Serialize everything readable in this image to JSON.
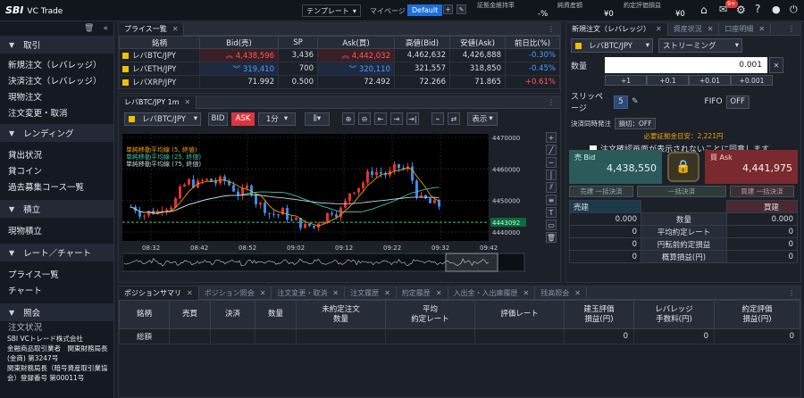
{
  "header": {
    "logo": "SBI",
    "app_name": "VC Trade",
    "template_label": "テンプレート",
    "mypage_label": "マイページ",
    "mypage_value": "Default",
    "margin_rate_label": "証拠金維持率",
    "margin_rate_value": "-%",
    "net_assets_label": "純資産額",
    "net_assets_value": "¥0",
    "pnl_label": "約定評価損益",
    "pnl_value": "¥0",
    "badge": "9+"
  },
  "sidebar": {
    "sections": [
      {
        "title": "取引",
        "items": [
          "新規注文（レバレッジ）",
          "決済注文（レバレッジ）",
          "現物注文",
          "注文変更・取消"
        ]
      },
      {
        "title": "レンディング",
        "items": [
          "貸出状況",
          "貸コイン",
          "過去募集コース一覧"
        ]
      },
      {
        "title": "積立",
        "items": [
          "現物積立"
        ]
      },
      {
        "title": "レート／チャート",
        "items": [
          "プライス一覧",
          "チャート"
        ]
      },
      {
        "title": "照会",
        "items": [
          "注文状況"
        ]
      }
    ],
    "footer": [
      "SBI VCトレード株式会社",
      "金融商品取引業者　関東財務局長",
      "(金商) 第3247号",
      "関東財務局長（暗号資産取引業協",
      "会）登録番号 第00011号"
    ]
  },
  "price_list": {
    "tab": "プライス一覧",
    "headers": [
      "銘柄",
      "Bid(売)",
      "SP",
      "Ask(買)",
      "高値(Bid)",
      "安値(Ask)",
      "前日比(%)"
    ],
    "rows": [
      {
        "symbol": "レバBTC/JPY",
        "bid": "4,438,596",
        "sp": "3,436",
        "ask": "4,442,032",
        "high": "4,462,632",
        "low": "4,426,888",
        "change": "-0.30%"
      },
      {
        "symbol": "レバETH/JPY",
        "bid": "319,410",
        "sp": "700",
        "ask": "320,110",
        "high": "321,557",
        "low": "318,850",
        "change": "-0.45%"
      },
      {
        "symbol": "レバXRP/JPY",
        "bid": "71.992",
        "sp": "0.500",
        "ask": "72.492",
        "high": "72.266",
        "low": "71.865",
        "change": "+0.61%"
      }
    ]
  },
  "chart": {
    "tab": "レバBTC/JPY 1m",
    "symbol": "レバBTC/JPY",
    "bid": "BID",
    "ask": "ASK",
    "interval": "1分",
    "display": "表示",
    "legend": [
      "単純移動平均線 (5, 終値)",
      "単純移動平均線 (25, 終値)",
      "単純移動平均線 (75, 終値)"
    ],
    "price_ticks": [
      "4470000",
      "4460000",
      "4450000",
      "4440000"
    ],
    "current_price": "4443092",
    "time_ticks": [
      "08:32",
      "08:42",
      "08:52",
      "09:02",
      "09:12",
      "09:22",
      "09:32",
      "09:42"
    ],
    "colors": {
      "up": "#e8312f",
      "down": "#3d8be8",
      "ma5": "#f0a000",
      "ma25": "#3ec4a8",
      "ma75": "#c8d0dc"
    }
  },
  "order": {
    "tabs": [
      "新規注文（レバレッジ）",
      "資産状況",
      "口座明細"
    ],
    "symbol": "レバBTC/JPY",
    "mode": "ストリーミング",
    "qty_label": "数量",
    "qty_value": "0.001",
    "steps": [
      "+1",
      "+0.1",
      "+0.01",
      "+0.001"
    ],
    "slippage_label": "スリッページ",
    "slippage_value": "5",
    "fifo_label": "FIFO",
    "fifo_value": "OFF",
    "settle_label": "決済同時発注",
    "settle_value": "損切：OFF",
    "required_margin": "必要証拠金目安：",
    "required_margin_value": "2,221円",
    "agree_text": "注文確認画面が表示されないことに同意します",
    "sell_label": "売 Bid",
    "sell_price": "4,438,550",
    "buy_label": "買 Ask",
    "buy_price": "4,441,975",
    "bulk_sell": "売建 一括決済",
    "bulk_all": "一括決済",
    "bulk_buy": "買建 一括決済",
    "sell_side": "売建",
    "buy_side": "買建",
    "summary_rows": [
      {
        "left": "0.000",
        "label": "数量",
        "right": "0.000"
      },
      {
        "left": "0",
        "label": "平均約定レート",
        "right": "0"
      },
      {
        "left": "0",
        "label": "円転前約定損益",
        "right": "0"
      },
      {
        "left": "0",
        "label": "概算損益(円)",
        "right": "0"
      }
    ]
  },
  "bottom": {
    "tabs": [
      "ポジションサマリ",
      "ポジション照会",
      "注文変更・取消",
      "注文履歴",
      "約定履歴",
      "入出金・入出庫履歴",
      "残高照会"
    ],
    "headers": [
      "銘柄",
      "売買",
      "決済",
      "数量",
      "未約定注文\n数量",
      "平均\n約定レート",
      "評価レート",
      "建玉評価\n損益(円)",
      "レバレッジ\n手数料(円)",
      "約定評価\n損益(円)"
    ],
    "total_row": {
      "label": "総額",
      "v1": "0",
      "v2": "0",
      "v3": "0"
    }
  }
}
